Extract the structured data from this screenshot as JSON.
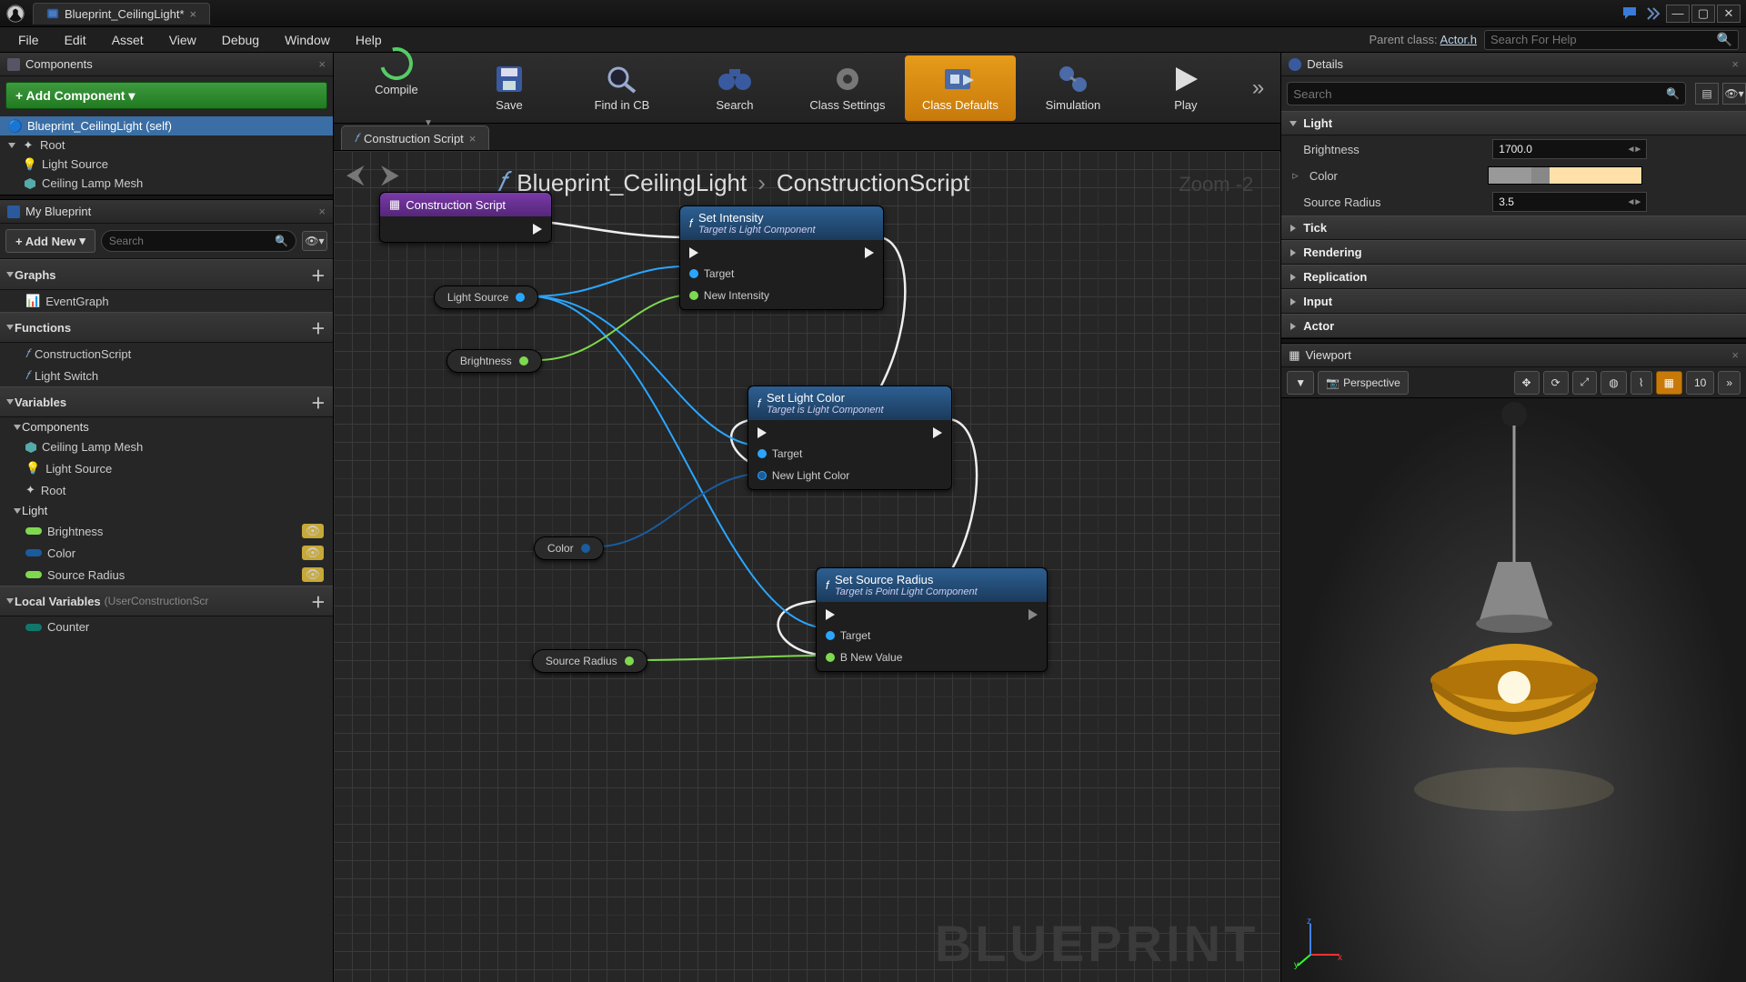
{
  "titlebar": {
    "tab_title": "Blueprint_CeilingLight*"
  },
  "menu": {
    "items": [
      "File",
      "Edit",
      "Asset",
      "View",
      "Debug",
      "Window",
      "Help"
    ],
    "parent_label": "Parent class:",
    "parent_link": "Actor.h",
    "help_placeholder": "Search For Help"
  },
  "toolbar": {
    "buttons": [
      "Compile",
      "Save",
      "Find in CB",
      "Search",
      "Class Settings",
      "Class Defaults",
      "Simulation",
      "Play"
    ],
    "active_index": 5
  },
  "components_panel": {
    "title": "Components",
    "add_label": "+ Add Component",
    "tree": [
      {
        "label": "Blueprint_CeilingLight (self)",
        "depth": 0,
        "selected": true,
        "icon": "sphere"
      },
      {
        "label": "Root",
        "depth": 0,
        "icon": "scene",
        "expand": true
      },
      {
        "label": "Light Source",
        "depth": 1,
        "icon": "light"
      },
      {
        "label": "Ceiling Lamp Mesh",
        "depth": 1,
        "icon": "mesh"
      }
    ]
  },
  "mybp": {
    "title": "My Blueprint",
    "addnew": "+ Add New",
    "search_placeholder": "Search",
    "sections": [
      {
        "head": "Graphs",
        "items": [
          {
            "label": "EventGraph",
            "icon": "graph"
          }
        ]
      },
      {
        "head": "Functions",
        "items": [
          {
            "label": "ConstructionScript",
            "icon": "func-cs"
          },
          {
            "label": "Light Switch",
            "icon": "func"
          }
        ]
      },
      {
        "head": "Variables",
        "sub": [
          {
            "subhead": "Components",
            "items": [
              {
                "label": "Ceiling Lamp Mesh",
                "icon": "mesh"
              },
              {
                "label": "Light Source",
                "icon": "light"
              },
              {
                "label": "Root",
                "icon": "scene"
              }
            ]
          },
          {
            "subhead": "Light",
            "items": [
              {
                "label": "Brightness",
                "pill": "#7fd84f",
                "eye": true
              },
              {
                "label": "Color",
                "pill": "#1a5c9e",
                "eye": true
              },
              {
                "label": "Source Radius",
                "pill": "#7fd84f",
                "eye": true
              }
            ]
          }
        ]
      },
      {
        "head": "Local Variables",
        "faint": "(UserConstructionScr",
        "items": [
          {
            "label": "Counter",
            "pill": "#11776b"
          }
        ]
      }
    ]
  },
  "graph": {
    "tab": "Construction Script",
    "breadcrumb": [
      "Blueprint_CeilingLight",
      "ConstructionScript"
    ],
    "zoom_hint": "Zoom -2",
    "watermark": "BLUEPRINT",
    "nodes": {
      "cs": {
        "title": "Construction Script"
      },
      "si": {
        "title": "Set Intensity",
        "sub": "Target is Light Component",
        "pins_in": [
          "Target",
          "New Intensity"
        ]
      },
      "slc": {
        "title": "Set Light Color",
        "sub": "Target is Light Component",
        "pins_in": [
          "Target",
          "New Light Color"
        ]
      },
      "ssr": {
        "title": "Set Source Radius",
        "sub": "Target is Point Light Component",
        "pins_in": [
          "Target",
          "B New Value"
        ]
      },
      "v_ls": {
        "label": "Light Source",
        "color": "#2aa6ff"
      },
      "v_br": {
        "label": "Brightness",
        "color": "#7fd84f"
      },
      "v_col": {
        "label": "Color",
        "color": "#1a5c9e"
      },
      "v_sr": {
        "label": "Source Radius",
        "color": "#7fd84f"
      }
    }
  },
  "details": {
    "title": "Details",
    "search_placeholder": "Search",
    "light_cat": "Light",
    "rows": {
      "brightness": {
        "label": "Brightness",
        "value": "1700.0"
      },
      "color": {
        "label": "Color"
      },
      "source_radius": {
        "label": "Source Radius",
        "value": "3.5"
      }
    },
    "cats": [
      "Tick",
      "Rendering",
      "Replication",
      "Input",
      "Actor"
    ]
  },
  "viewport": {
    "title": "Viewport",
    "mode": "Perspective",
    "snap": "10"
  }
}
